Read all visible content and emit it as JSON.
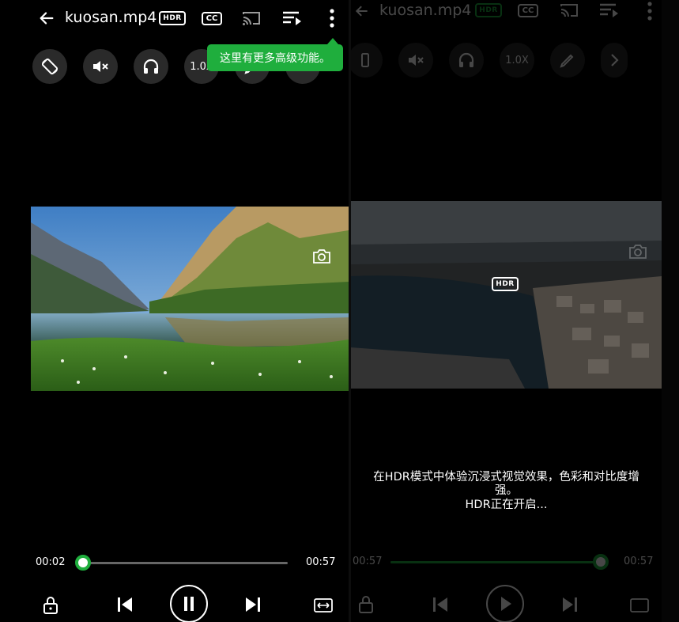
{
  "left": {
    "title": "kuosan.mp4",
    "topbar_icons": [
      "back-icon",
      "hdr-icon",
      "cc-icon",
      "cast-icon",
      "playlist-icon",
      "more-icon"
    ],
    "hdr_label": "HDR",
    "cc_label": "CC",
    "tooltip": "这里有更多高级功能。",
    "speed_label": "1.0X",
    "current_time": "00:02",
    "total_time": "00:57",
    "progress": 0.0,
    "bottom_icons": [
      "lock-icon",
      "previous-icon",
      "pause-icon",
      "next-icon",
      "fit-screen-icon"
    ]
  },
  "right": {
    "title": "kuosan.mp4",
    "hdr_label": "HDR",
    "cc_label": "CC",
    "speed_label": "1.0X",
    "hdr_message_line1": "在HDR模式中体验沉浸式视觉效果，色彩和对比度增",
    "hdr_message_line2": "强。",
    "hdr_message_line3": "HDR正在开启...",
    "current_time": "00:57",
    "total_time": "00:57",
    "progress": 1.0,
    "bottom_icons": [
      "lock-icon",
      "previous-icon",
      "play-icon",
      "next-icon",
      "fit-screen-icon"
    ]
  },
  "colors": {
    "accent": "#1fae3d",
    "background": "#000000",
    "button_bg": "#2a2a2a"
  }
}
